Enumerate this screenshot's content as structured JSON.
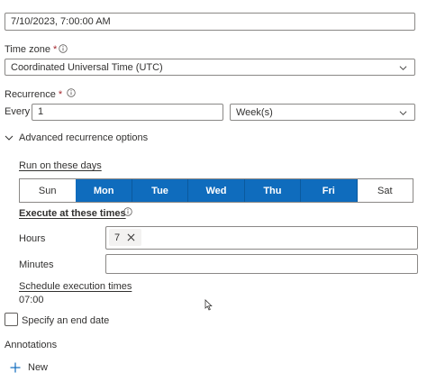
{
  "start_time": {
    "value": "7/10/2023, 7:00:00 AM"
  },
  "time_zone": {
    "label": "Time zone",
    "required_mark": "*",
    "value": "Coordinated Universal Time (UTC)"
  },
  "recurrence": {
    "label": "Recurrence",
    "required_mark": "*",
    "every_label": "Every",
    "interval_value": "1",
    "unit_value": "Week(s)"
  },
  "advanced": {
    "toggle_label": "Advanced recurrence options"
  },
  "run_on_days": {
    "label": "Run on these days",
    "days": [
      {
        "label": "Sun",
        "selected": false
      },
      {
        "label": "Mon",
        "selected": true
      },
      {
        "label": "Tue",
        "selected": true
      },
      {
        "label": "Wed",
        "selected": true
      },
      {
        "label": "Thu",
        "selected": true
      },
      {
        "label": "Fri",
        "selected": true
      },
      {
        "label": "Sat",
        "selected": false
      }
    ]
  },
  "execute_times": {
    "label": "Execute at these times",
    "hours_label": "Hours",
    "hours_tags": [
      "7"
    ],
    "minutes_label": "Minutes",
    "minutes_value": ""
  },
  "schedule": {
    "label": "Schedule execution times",
    "value": "07:00"
  },
  "end_date": {
    "label": "Specify an end date",
    "checked": false
  },
  "annotations": {
    "label": "Annotations",
    "new_label": "New"
  },
  "colors": {
    "accent": "#0f6cbd",
    "required": "#a4262c",
    "text": "#323130",
    "border": "#8a8886"
  }
}
